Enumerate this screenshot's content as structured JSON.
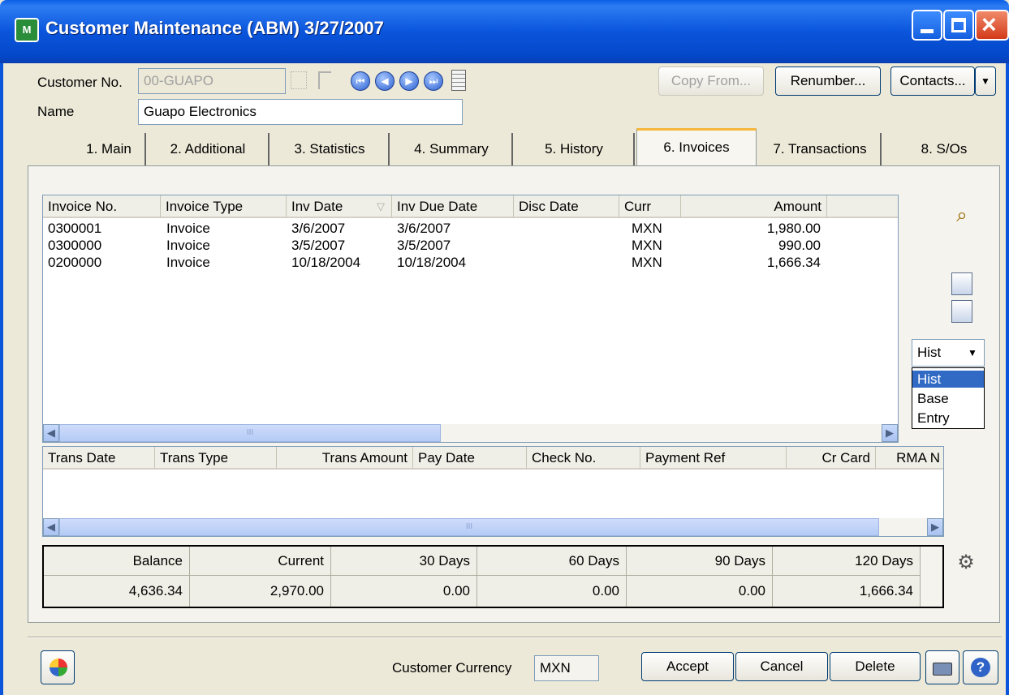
{
  "window": {
    "title": "Customer Maintenance (ABM) 3/27/2007",
    "app_icon_text": "M"
  },
  "header": {
    "customer_no_label": "Customer No.",
    "customer_no_value": "00-GUAPO",
    "name_label": "Name",
    "name_value": "Guapo Electronics",
    "copy_from_label": "Copy From...",
    "renumber_label": "Renumber...",
    "contacts_label": "Contacts..."
  },
  "tabs": [
    {
      "label": "1. Main"
    },
    {
      "label": "2. Additional"
    },
    {
      "label": "3. Statistics"
    },
    {
      "label": "4. Summary"
    },
    {
      "label": "5. History"
    },
    {
      "label": "6. Invoices",
      "active": true
    },
    {
      "label": "7. Transactions"
    },
    {
      "label": "8. S/Os"
    }
  ],
  "invoices": {
    "columns": [
      "Invoice No.",
      "Invoice Type",
      "Inv Date",
      "Inv Due Date",
      "Disc Date",
      "Curr",
      "Amount"
    ],
    "rows": [
      [
        "0300001",
        "Invoice",
        "3/6/2007",
        "3/6/2007",
        "",
        "MXN",
        "1,980.00"
      ],
      [
        "0300000",
        "Invoice",
        "3/5/2007",
        "3/5/2007",
        "",
        "MXN",
        "990.00"
      ],
      [
        "0200000",
        "Invoice",
        "10/18/2004",
        "10/18/2004",
        "",
        "MXN",
        "1,666.34"
      ]
    ],
    "scroll_thumb_text": "III"
  },
  "transactions": {
    "columns": [
      "Trans Date",
      "Trans Type",
      "Trans Amount",
      "Pay Date",
      "Check No.",
      "Payment Ref",
      "Cr Card",
      "RMA N"
    ],
    "rows": [],
    "scroll_thumb_text": "III"
  },
  "view_selector": {
    "selected": "Hist",
    "options": [
      "Hist",
      "Base",
      "Entry"
    ]
  },
  "aging": {
    "headers": [
      "Balance",
      "Current",
      "30 Days",
      "60 Days",
      "90 Days",
      "120 Days"
    ],
    "values": [
      "4,636.34",
      "2,970.00",
      "0.00",
      "0.00",
      "0.00",
      "1,666.34"
    ]
  },
  "footer": {
    "currency_label": "Customer Currency",
    "currency_value": "MXN",
    "accept_label": "Accept",
    "cancel_label": "Cancel",
    "delete_label": "Delete"
  }
}
